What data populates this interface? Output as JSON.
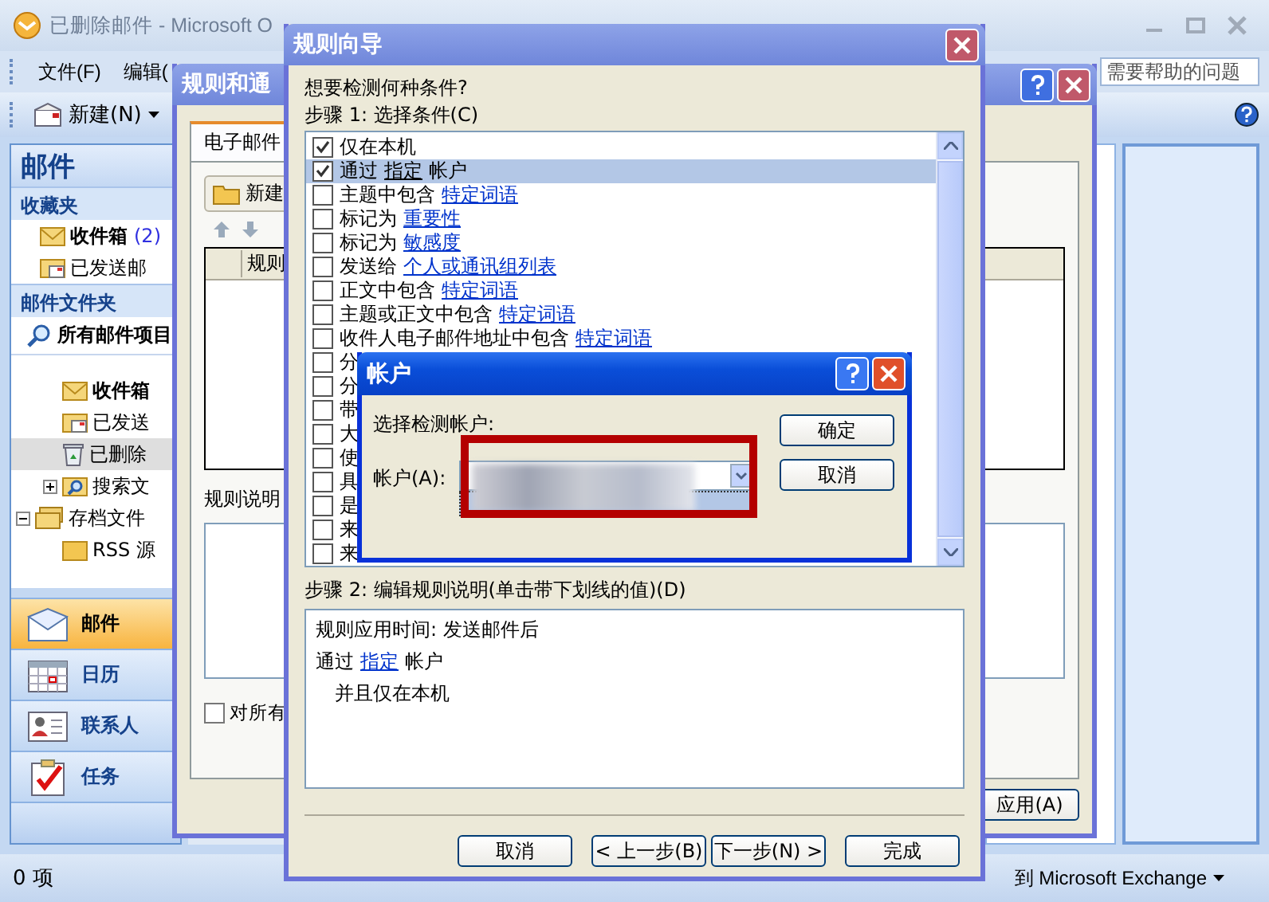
{
  "outlook": {
    "title": "已删除邮件 - Microsoft O",
    "menu": [
      "文件(F)",
      "编辑("
    ],
    "help_search": {
      "placeholder": "需要帮助的问题"
    },
    "toolbar": {
      "new_button": "新建(N)"
    },
    "nav": {
      "header": "邮件",
      "favorites_title": "收藏夹",
      "favorites": [
        {
          "label": "收件箱",
          "count": "(2)",
          "unread": true,
          "kind": "inbox"
        },
        {
          "label": "已发送邮",
          "unread": false,
          "kind": "sent"
        }
      ],
      "folders_title": "邮件文件夹",
      "all_items": "所有邮件项目",
      "tree": [
        {
          "children": [
            {
              "label": "收件箱",
              "unread": true,
              "selected": false,
              "kind": "inbox"
            },
            {
              "label": "已发送",
              "unread": false,
              "selected": false,
              "kind": "sent"
            },
            {
              "label": "已删除",
              "unread": false,
              "selected": true,
              "kind": "trash"
            },
            {
              "label": "搜索文",
              "unread": false,
              "selected": false,
              "kind": "search",
              "expanded": false
            }
          ]
        },
        {
          "label": "存档文件",
          "unread": false,
          "selected": false,
          "kind": "stack",
          "expanded": true,
          "children": [
            {
              "label": "RSS 源",
              "unread": false,
              "selected": false,
              "kind": "folder"
            }
          ]
        }
      ],
      "buttons": [
        {
          "label": "邮件",
          "kind": "mail",
          "selected": true
        },
        {
          "label": "日历",
          "kind": "calendar",
          "selected": false
        },
        {
          "label": "联系人",
          "kind": "contacts",
          "selected": false
        },
        {
          "label": "任务",
          "kind": "tasks",
          "selected": false
        }
      ]
    },
    "status": {
      "items": "0 项",
      "connection": "到 Microsoft Exchange"
    }
  },
  "rules_dialog": {
    "title": "规则和通",
    "tab": "电子邮件",
    "new_rule_button": "新建",
    "column": "规则",
    "description_label": "规则说明",
    "apply_all": {
      "label": "对所有",
      "checked": false
    },
    "apply_button": "应用(A)"
  },
  "wizard": {
    "title": "规则向导",
    "question": "想要检测何种条件?",
    "step1": "步骤 1: 选择条件(C)",
    "conditions": [
      {
        "prefix": "仅在本机",
        "checked": true,
        "selected": false
      },
      {
        "prefix": "通过",
        "link": "指定",
        "suffix": "帐户",
        "checked": true,
        "selected": true
      },
      {
        "prefix": "主题中包含",
        "link": "特定词语",
        "checked": false,
        "selected": false
      },
      {
        "prefix": "标记为",
        "link": "重要性",
        "checked": false,
        "selected": false
      },
      {
        "prefix": "标记为",
        "link": "敏感度",
        "checked": false,
        "selected": false
      },
      {
        "prefix": "发送给",
        "link": "个人或通讯组列表",
        "checked": false,
        "selected": false
      },
      {
        "prefix": "正文中包含",
        "link": "特定词语",
        "checked": false,
        "selected": false
      },
      {
        "prefix": "主题或正文中包含",
        "link": "特定词语",
        "checked": false,
        "selected": false
      },
      {
        "prefix": "收件人电子邮件地址中包含",
        "link": "特定词语",
        "checked": false,
        "selected": false
      },
      {
        "prefix": "分",
        "checked": false,
        "selected": false
      },
      {
        "prefix": "分",
        "checked": false,
        "selected": false
      },
      {
        "prefix": "带",
        "checked": false,
        "selected": false
      },
      {
        "prefix": "大",
        "checked": false,
        "selected": false
      },
      {
        "prefix": "使",
        "checked": false,
        "selected": false
      },
      {
        "prefix": "具",
        "checked": false,
        "selected": false
      },
      {
        "prefix": "是",
        "checked": false,
        "selected": false
      },
      {
        "prefix": "来",
        "checked": false,
        "selected": false
      },
      {
        "prefix": "来",
        "checked": false,
        "selected": false
      }
    ],
    "step2": "步骤 2: 编辑规则说明(单击带下划线的值)(D)",
    "description": [
      {
        "kind": "header",
        "prefix": "规则应用时间: 发送邮件后"
      },
      {
        "kind": "condition",
        "prefix": "通过",
        "link": "指定",
        "suffix": "帐户"
      },
      {
        "kind": "and",
        "prefix": "并且仅在本机"
      }
    ],
    "buttons": [
      "取消",
      "< 上一步(B)",
      "下一步(N) >",
      "完成"
    ]
  },
  "account_dialog": {
    "title": "帐户",
    "prompt": "选择检测帐户:",
    "field_label": "帐户(A):",
    "highlighted": true,
    "ok": "确定",
    "cancel": "取消"
  }
}
